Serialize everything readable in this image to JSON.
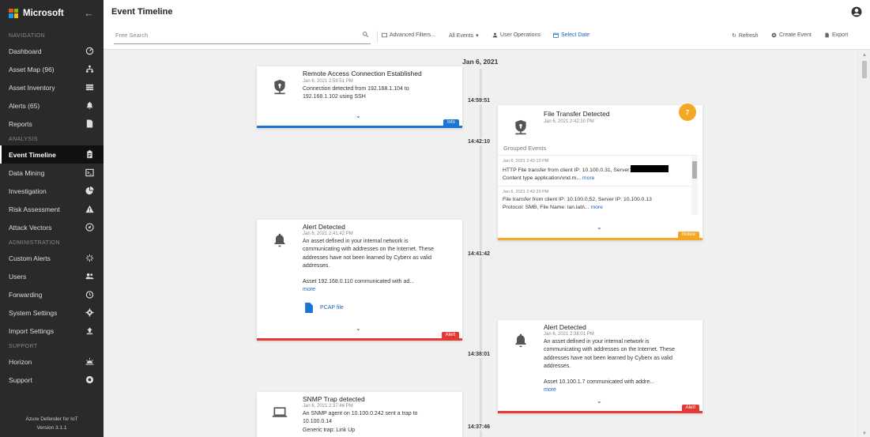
{
  "brand": {
    "name": "Microsoft"
  },
  "sidebar": {
    "sections": {
      "navigation": "NAVIGATION",
      "analysis": "ANALYSIS",
      "administration": "ADMINISTRATION",
      "support": "SUPPORT"
    },
    "items": [
      {
        "label": "Dashboard",
        "icon": "gauge-icon"
      },
      {
        "label": "Asset Map (96)",
        "icon": "sitemap-icon"
      },
      {
        "label": "Asset Inventory",
        "icon": "list-icon"
      },
      {
        "label": "Alerts (65)",
        "icon": "bell-icon"
      },
      {
        "label": "Reports",
        "icon": "file-icon"
      },
      {
        "label": "Event Timeline",
        "icon": "clipboard-icon",
        "active": true
      },
      {
        "label": "Data Mining",
        "icon": "terminal-icon"
      },
      {
        "label": "Investigation",
        "icon": "pie-icon"
      },
      {
        "label": "Risk Assessment",
        "icon": "warning-icon"
      },
      {
        "label": "Attack Vectors",
        "icon": "compass-icon"
      },
      {
        "label": "Custom Alerts",
        "icon": "sparkle-icon"
      },
      {
        "label": "Users",
        "icon": "users-icon"
      },
      {
        "label": "Forwarding",
        "icon": "clock-icon"
      },
      {
        "label": "System Settings",
        "icon": "gear-icon"
      },
      {
        "label": "Import Settings",
        "icon": "upload-icon"
      },
      {
        "label": "Horizon",
        "icon": "horizon-icon"
      },
      {
        "label": "Support",
        "icon": "lifebuoy-icon"
      }
    ],
    "footer_line1": "Azure Defender for IoT",
    "footer_line2": "Version 3.1.1"
  },
  "header": {
    "title": "Event Timeline"
  },
  "toolbar": {
    "search_placeholder": "Free Search",
    "advanced_filters": "Advanced Filters...",
    "all_events": "All Events",
    "user_operations": "User Operations",
    "select_date": "Select Date",
    "refresh": "Refresh",
    "create_event": "Create Event",
    "export": "Export"
  },
  "timeline": {
    "date": "Jan 6, 2021",
    "times": [
      "14:59:51",
      "14:42:10",
      "14:41:42",
      "14:38:01",
      "14:37:46"
    ],
    "events": [
      {
        "title": "Remote Access Connection Established",
        "time": "Jan 6, 2021 2:59:51 PM",
        "body_line1": "Connection detected from 192.168.1.104 to",
        "body_line2": "192.168.1.102 using SSH",
        "badge": "Info",
        "color": "#1976d2"
      },
      {
        "title": "File Transfer Detected",
        "time": "Jan 6, 2021 2:42:10 PM",
        "count": "7",
        "grouped_title": "Grouped Events",
        "grouped": [
          {
            "time": "Jan 6, 2021 2:42:10 PM",
            "line1": "HTTP File transfer from client IP: 10.100.0.31, Server:",
            "line2": "Content type application/vnd.m...",
            "more": "more"
          },
          {
            "time": "Jan 6, 2021 2:42:20 PM",
            "line1": "File transfer from client IP: 10.100.0.52, Server IP: 10.100.0.13",
            "line2": "Protocol: SMB, File Name: lan.lab\\...",
            "more": "more"
          }
        ],
        "badge": "Notice",
        "color": "#f5a623"
      },
      {
        "title": "Alert Detected",
        "time": "Jan 6, 2021 2:41:42 PM",
        "body_lines": [
          "An asset defined in your internal network is",
          "communicating with addresses on the Internet. These",
          "addresses have not been learned by Cyberx as valid",
          "addresses."
        ],
        "detail": "Asset 192.168.0.110 communicated with ad...",
        "more": "more",
        "attachment": "PCAP file",
        "badge": "Alert",
        "color": "#e53935"
      },
      {
        "title": "Alert Detected",
        "time": "Jan 6, 2021 2:38:01 PM",
        "body_lines": [
          "An asset defined in your internal network is",
          "communicating with addresses on the Internet. These",
          "addresses have not been learned by Cyberx as valid",
          "addresses."
        ],
        "detail": "Asset 10.100.1.7 communicated with addre...",
        "more": "more",
        "badge": "Alert",
        "color": "#e53935"
      },
      {
        "title": "SNMP Trap detected",
        "time": "Jan 6, 2021 2:37:46 PM",
        "body_lines": [
          "An SNMP agent on 10.100.0.242 sent a trap to",
          "10.100.0.14",
          "Generic trap: Link Up"
        ]
      }
    ]
  }
}
